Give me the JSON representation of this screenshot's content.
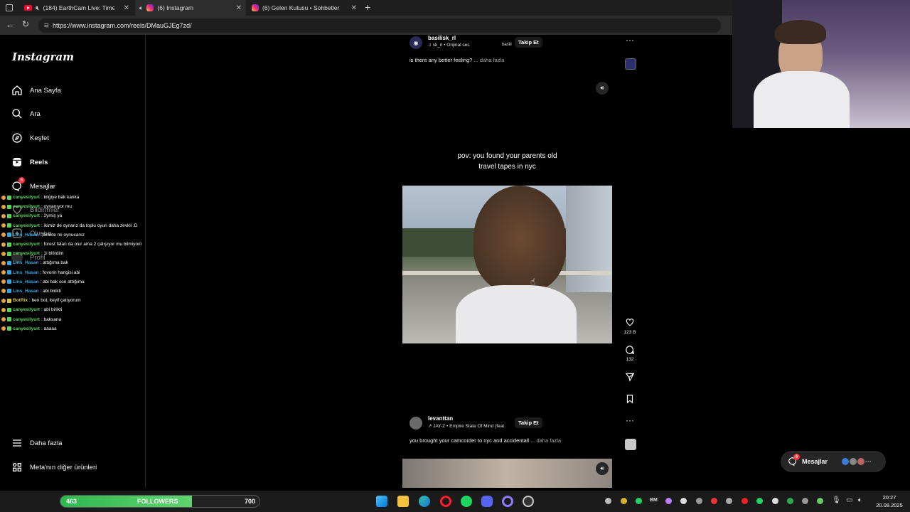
{
  "browser": {
    "tabs": [
      {
        "title": "(184) EarthCam Live: Times S"
      },
      {
        "title": "(6) Instagram"
      },
      {
        "title": "(6) Gelen Kutusu • Sohbetler"
      }
    ],
    "url": "https://www.instagram.com/reels/DMauGJEg7zd/"
  },
  "sidebar": {
    "logo": "Instagram",
    "items": [
      {
        "label": "Ana Sayfa"
      },
      {
        "label": "Ara"
      },
      {
        "label": "Keşfet"
      },
      {
        "label": "Reels"
      },
      {
        "label": "Mesajlar",
        "badge": "6"
      },
      {
        "label": "Bildirimler"
      },
      {
        "label": "Oluştur"
      },
      {
        "label": "Profil"
      }
    ],
    "more": "Daha fazla",
    "meta": "Meta'nın diğer ürünleri"
  },
  "chat": [
    {
      "user": "canyesilyurt",
      "msg": ": bilgiye bak kanka",
      "color": "#5bd35b"
    },
    {
      "user": "canyesilyurt",
      "msg": ": oynanıyor mu",
      "color": "#5bd35b"
    },
    {
      "user": "canyesilyurt",
      "msg": ": 2ymiş ya",
      "color": "#5bd35b"
    },
    {
      "user": "canyesilyurt",
      "msg": ": ikimiz de oynarız da toplu oyun daha zevkli :D",
      "color": "#5bd35b"
    },
    {
      "user": "Lins_Hasan",
      "msg": ": birlikte mi oynucanız",
      "color": "#35a8e0"
    },
    {
      "user": "canyesilyurt",
      "msg": ": forest falan da olur ama 2 çalışıyor mu bilmiyom",
      "color": "#5bd35b"
    },
    {
      "user": "canyesilyurt",
      "msg": ": 1i bitirdim",
      "color": "#5bd35b"
    },
    {
      "user": "Lins_Hasan",
      "msg": ": attığıma bak",
      "color": "#35a8e0"
    },
    {
      "user": "Lins_Hasan",
      "msg": ": fovorin hangisi abi",
      "color": "#35a8e0"
    },
    {
      "user": "Lins_Hasan",
      "msg": ": abi bak son attığıma",
      "color": "#35a8e0"
    },
    {
      "user": "Lins_Hasan",
      "msg": ": abi birikti",
      "color": "#35a8e0"
    },
    {
      "user": "BotRix",
      "msg": ": ben bot, keyif çatıyorum",
      "color": "#d8c43a"
    },
    {
      "user": "canyesilyurt",
      "msg": ": abi birikti",
      "color": "#5bd35b"
    },
    {
      "user": "canyesilyurt",
      "msg": ": baksana",
      "color": "#5bd35b"
    },
    {
      "user": "canyesilyurt",
      "msg": ": aaaaa",
      "color": "#5bd35b"
    }
  ],
  "post1": {
    "username": "basilisk_rl",
    "audio": "sk_rl • Orijinal ses",
    "sticker": "basili",
    "follow": "Takip Et",
    "caption": "is there any better feeling?",
    "more": "... daha fazla",
    "overlay_line1": "pov: you found your parents old",
    "overlay_line2": "travel tapes in nyc",
    "likes": "123 B",
    "comments": "132"
  },
  "post2": {
    "username": "levanttan",
    "audio": "JAY-Z • Empire State Of Mind (feat.",
    "follow": "Takip Et",
    "caption": "you brought your camcorder to nyc and accidentall",
    "more": "... daha fazla"
  },
  "messages_float": {
    "label": "Mesajlar",
    "badge": "6"
  },
  "followers": {
    "current": "463",
    "label": "FOLLOWERS",
    "goal": "700",
    "progress": 0.66
  },
  "clock": {
    "time": "20:27",
    "date": "20.08.2025"
  },
  "tray_text": "BM"
}
